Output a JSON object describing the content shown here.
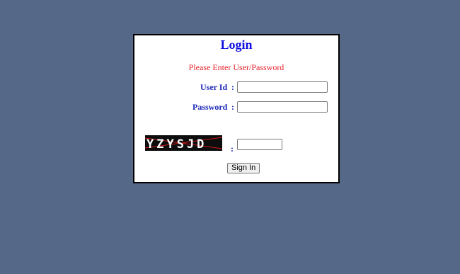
{
  "login": {
    "title": "Login",
    "message": "Please Enter User/Password",
    "user_id_label": "User Id",
    "password_label": "Password",
    "colon": ":",
    "user_id_value": "",
    "password_value": "",
    "captcha_text": "YZYSJD",
    "captcha_input_value": "",
    "signin_label": "Sign In"
  },
  "colors": {
    "background": "#556887",
    "title": "#1010e0",
    "message": "#e8202a",
    "label": "#1f2bb8"
  }
}
